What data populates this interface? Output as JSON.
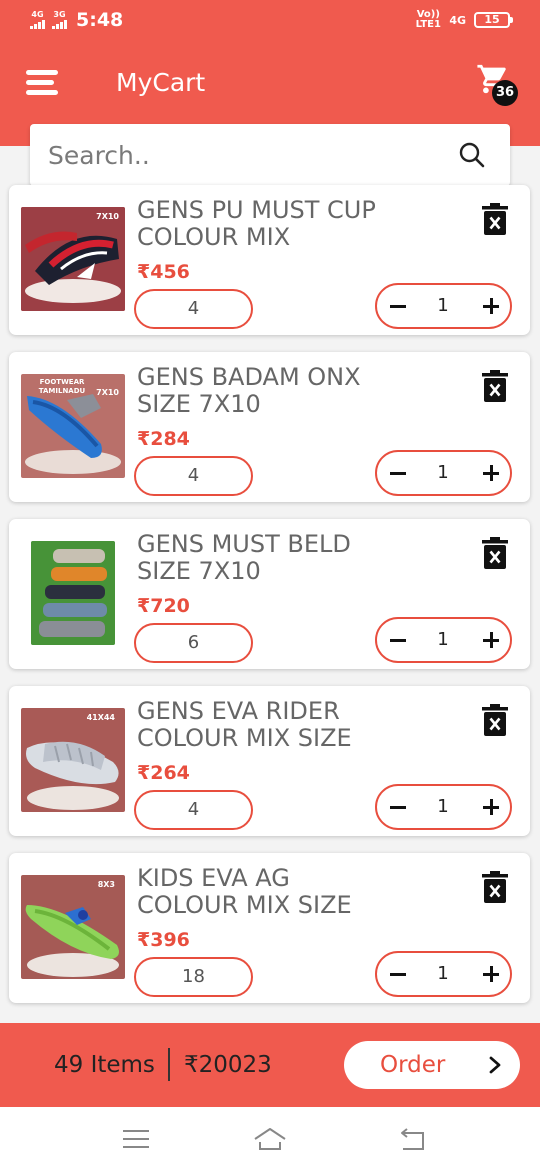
{
  "status_bar": {
    "sim1": "4G",
    "sim2": "3G",
    "time": "5:48",
    "volte": "Vo)) LTE1",
    "network": "4G",
    "battery": "15"
  },
  "app_bar": {
    "title": "MyCart",
    "menu_icon": "hamburger-menu-icon",
    "cart_icon": "shopping-cart-icon",
    "cart_count": "36"
  },
  "search": {
    "placeholder": "Search..",
    "value": "",
    "icon": "search-icon"
  },
  "cart_items": [
    {
      "name": "GENS PU MUST CUP COLOUR MIX",
      "price": "₹456",
      "size": "4",
      "quantity": "1",
      "thumb_label": "7X10"
    },
    {
      "name": "GENS BADAM ONX SIZE 7X10",
      "price": "₹284",
      "size": "4",
      "quantity": "1",
      "thumb_label": "7X10",
      "thumb_label_2": "FOOTWEAR TAMILNADU"
    },
    {
      "name": "GENS MUST BELD SIZE 7X10",
      "price": "₹720",
      "size": "6",
      "quantity": "1",
      "thumb_label": ""
    },
    {
      "name": "GENS EVA RIDER COLOUR MIX SIZE",
      "price": "₹264",
      "size": "4",
      "quantity": "1",
      "thumb_label": "41X44"
    },
    {
      "name": "KIDS EVA AG COLOUR MIX SIZE",
      "price": "₹396",
      "size": "18",
      "quantity": "1",
      "thumb_label": "8X3"
    }
  ],
  "summary": {
    "items": "49 Items",
    "total": "₹20023",
    "order_label": "Order",
    "order_icon": "chevron-right-icon"
  },
  "colors": {
    "primary": "#f05a4e",
    "accent": "#e84e3e",
    "text": "#666666"
  },
  "system_nav": {
    "menu_icon": "recent-apps-icon",
    "home_icon": "home-icon",
    "back_icon": "back-icon"
  }
}
